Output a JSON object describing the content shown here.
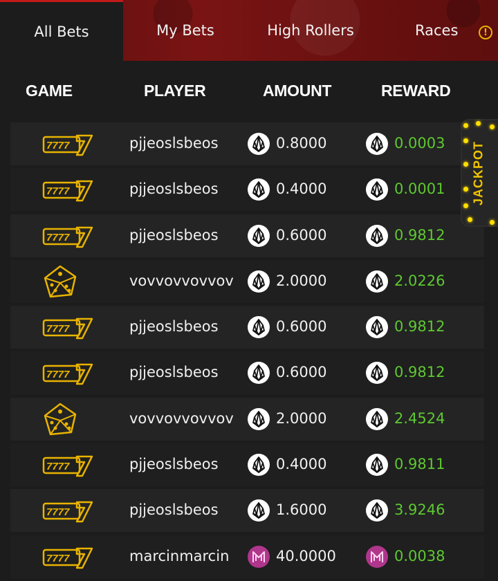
{
  "tabs": [
    {
      "label": "All Bets",
      "active": true
    },
    {
      "label": "My Bets",
      "active": false
    },
    {
      "label": "High Rollers",
      "active": false
    },
    {
      "label": "Races",
      "active": false
    }
  ],
  "info_icon": "!",
  "columns": {
    "game": "GAME",
    "player": "PLAYER",
    "amount": "AMOUNT",
    "reward": "REWARD"
  },
  "jackpot_label": "JACKPOT",
  "colors": {
    "accent": "#e9b300",
    "reward_green": "#5fc832",
    "tab_red": "#7a1414",
    "active_border": "#c21a1a"
  },
  "rows": [
    {
      "game": "slots-icon",
      "player": "pjjeoslsbeos",
      "token": "eos",
      "amount": "0.8000",
      "reward": "0.0003"
    },
    {
      "game": "slots-icon",
      "player": "pjjeoslsbeos",
      "token": "eos",
      "amount": "0.4000",
      "reward": "0.0001"
    },
    {
      "game": "slots-icon",
      "player": "pjjeoslsbeos",
      "token": "eos",
      "amount": "0.6000",
      "reward": "0.9812"
    },
    {
      "game": "dice-icon",
      "player": "vovvovvovvov",
      "token": "eos",
      "amount": "2.0000",
      "reward": "2.0226"
    },
    {
      "game": "slots-icon",
      "player": "pjjeoslsbeos",
      "token": "eos",
      "amount": "0.6000",
      "reward": "0.9812"
    },
    {
      "game": "slots-icon",
      "player": "pjjeoslsbeos",
      "token": "eos",
      "amount": "0.6000",
      "reward": "0.9812"
    },
    {
      "game": "dice-icon",
      "player": "vovvovvovvov",
      "token": "eos",
      "amount": "2.0000",
      "reward": "2.4524"
    },
    {
      "game": "slots-icon",
      "player": "pjjeoslsbeos",
      "token": "eos",
      "amount": "0.4000",
      "reward": "0.9811"
    },
    {
      "game": "slots-icon",
      "player": "pjjeoslsbeos",
      "token": "eos",
      "amount": "1.6000",
      "reward": "3.9246"
    },
    {
      "game": "slots-icon",
      "player": "marcinmarcin",
      "token": "meetone",
      "amount": "40.0000",
      "reward": "0.0038"
    }
  ]
}
